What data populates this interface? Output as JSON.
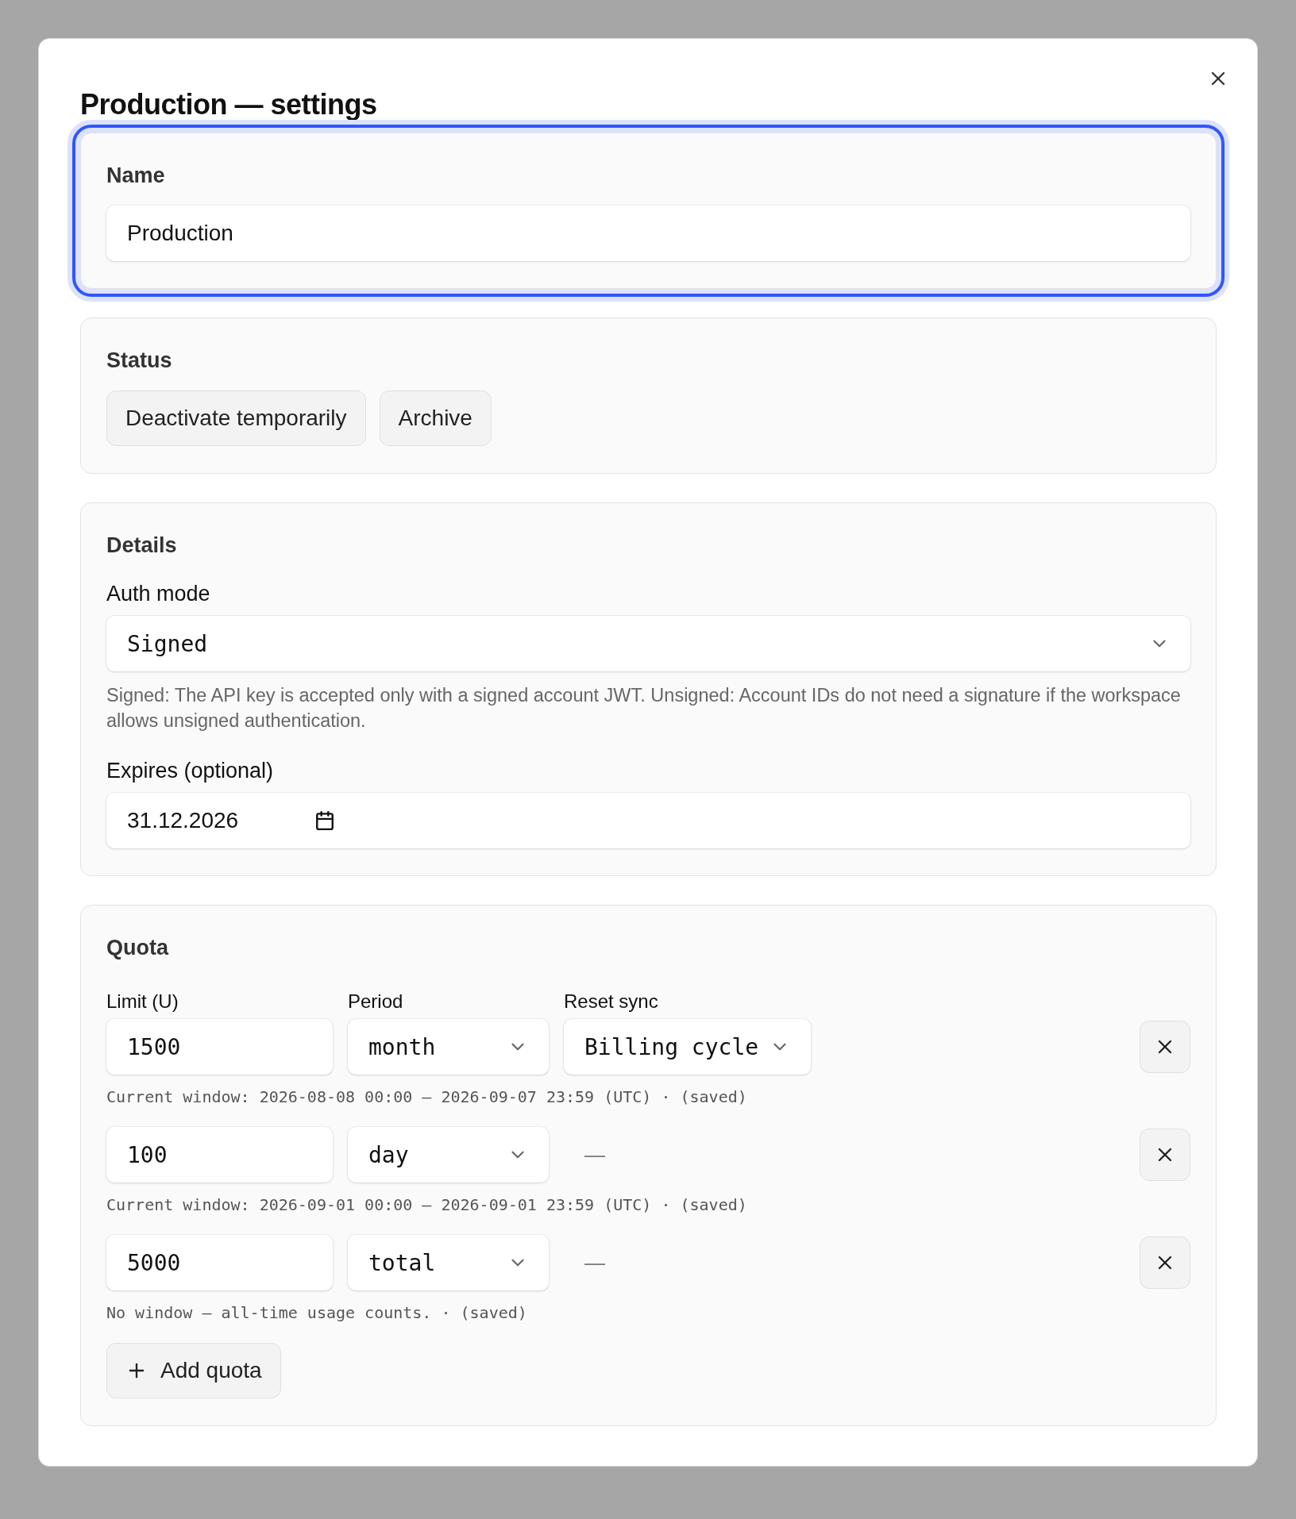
{
  "dialog": {
    "title": "Production — settings"
  },
  "name_section": {
    "focused": true,
    "heading": "Name",
    "value": "Production"
  },
  "status_section": {
    "focused": false,
    "heading": "Status",
    "buttons": [
      "Deactivate temporarily",
      "Archive"
    ]
  },
  "details_section": {
    "focused": false,
    "heading": "Details",
    "auth_label": "Auth mode",
    "auth_value": "Signed",
    "auth_help": "Signed: The API key is accepted only with a signed account JWT. Unsigned: Account IDs do not need a signature if the workspace allows unsigned authentication.",
    "expires_label": "Expires (optional)",
    "expires_value": "31.12.2026"
  },
  "quota_section": {
    "focused": false,
    "heading": "Quota",
    "columns": [
      "Limit (U)",
      "Period",
      "Reset sync"
    ],
    "rows": [
      {
        "limit": "1500",
        "period": "month",
        "reset": {
          "kind": "select",
          "text": "Billing cycle"
        },
        "note": "Current window: 2026-08-08 00:00 – 2026-09-07 23:59 (UTC) · (saved)"
      },
      {
        "limit": "100",
        "period": "day",
        "reset": {
          "kind": "none",
          "text": "—"
        },
        "note": "Current window: 2026-09-01 00:00 – 2026-09-01 23:59 (UTC) · (saved)"
      },
      {
        "limit": "5000",
        "period": "total",
        "reset": {
          "kind": "none",
          "text": "—"
        },
        "note": "No window — all-time usage counts. · (saved)"
      }
    ],
    "add_button": "Add quota"
  }
}
